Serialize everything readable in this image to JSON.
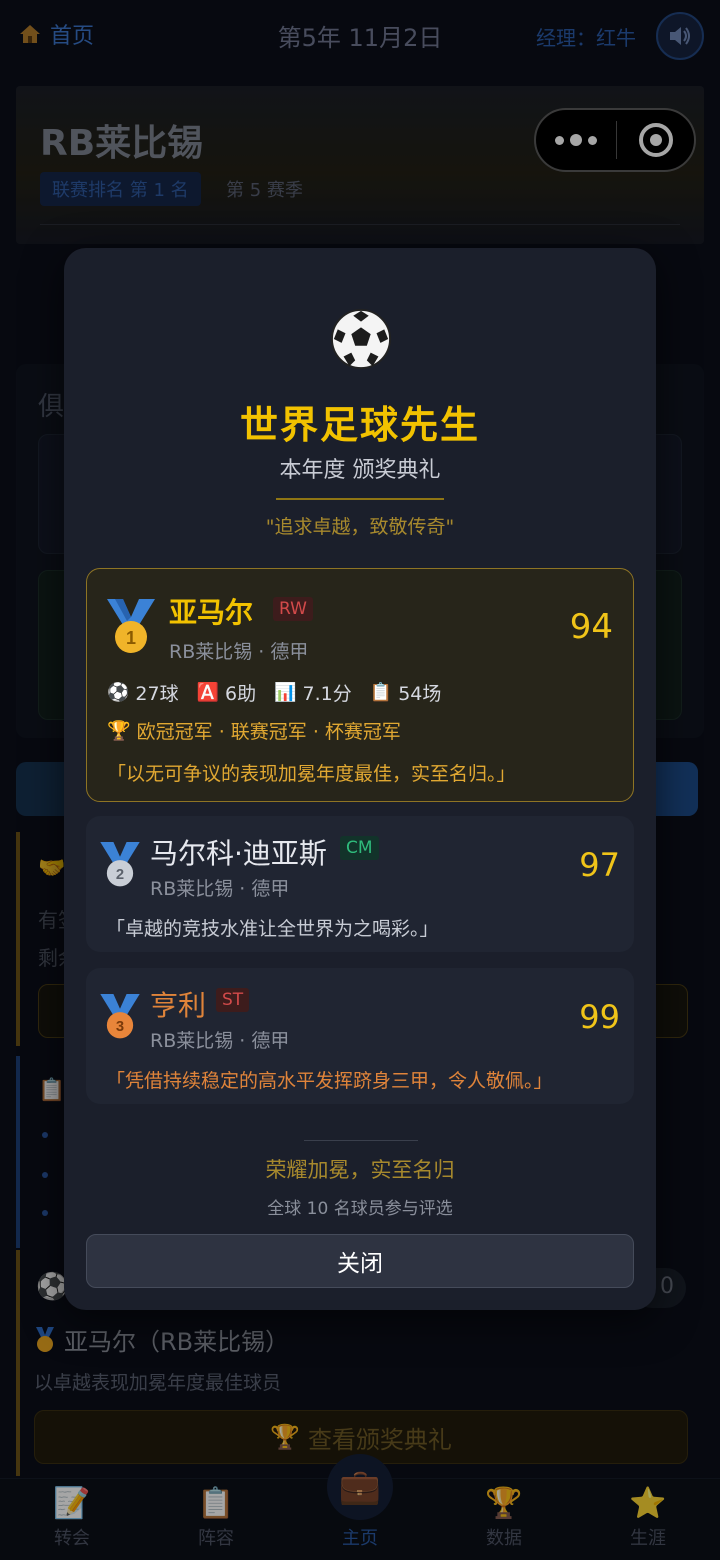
{
  "topbar": {
    "home_label": "首页",
    "date": "第5年 11月2日",
    "manager": "经理：红牛"
  },
  "team": {
    "name": "RB莱比锡",
    "rank": "联赛排名 第 1 名",
    "season": "第 5 赛季"
  },
  "background": {
    "card_title": "俱",
    "sec1_have": "有签",
    "sec1_left": "剩余",
    "sec3_pill": "0",
    "winner": "亚马尔（RB莱比锡）",
    "winner_desc": "以卓越表现加冕年度最佳球员",
    "ceremony_btn": "查看颁奖典礼"
  },
  "tabs": [
    {
      "label": "转会",
      "icon": "edit-icon"
    },
    {
      "label": "阵容",
      "icon": "clipboard-icon"
    },
    {
      "label": "主页",
      "icon": "briefcase-icon"
    },
    {
      "label": "数据",
      "icon": "trophy-icon"
    },
    {
      "label": "生涯",
      "icon": "star-icon"
    }
  ],
  "active_tab": "主页",
  "modal": {
    "title": "世界足球先生",
    "subtitle": "本年度 颁奖典礼",
    "motto": "\"追求卓越，致敬传奇\"",
    "players": [
      {
        "rank": 1,
        "medal": "gold",
        "name": "亚马尔",
        "position": "RW",
        "club": "RB莱比锡 · 德甲",
        "rating": "94",
        "stats": {
          "goals": "27球",
          "assists": "6助",
          "avg_rating": "7.1分",
          "apps": "54场"
        },
        "honors": "欧冠冠军 · 联赛冠军 · 杯赛冠军",
        "quote": "「以无可争议的表现加冕年度最佳，实至名归。」"
      },
      {
        "rank": 2,
        "medal": "silver",
        "name": "马尔科·迪亚斯",
        "position": "CM",
        "club": "RB莱比锡 · 德甲",
        "rating": "97",
        "quote": "「卓越的竞技水准让全世界为之喝彩。」"
      },
      {
        "rank": 3,
        "medal": "bronze",
        "name": "亨利",
        "position": "ST",
        "club": "RB莱比锡 · 德甲",
        "rating": "99",
        "quote": "「凭借持续稳定的高水平发挥跻身三甲，令人敬佩。」"
      }
    ],
    "footer_line": "荣耀加冕，实至名归",
    "voters": "全球 10 名球员参与评选",
    "close_label": "关闭"
  },
  "colors": {
    "gold": "#f2c200",
    "accent_blue": "#2a5aa5",
    "modal_bg": "#1b1f2b"
  }
}
